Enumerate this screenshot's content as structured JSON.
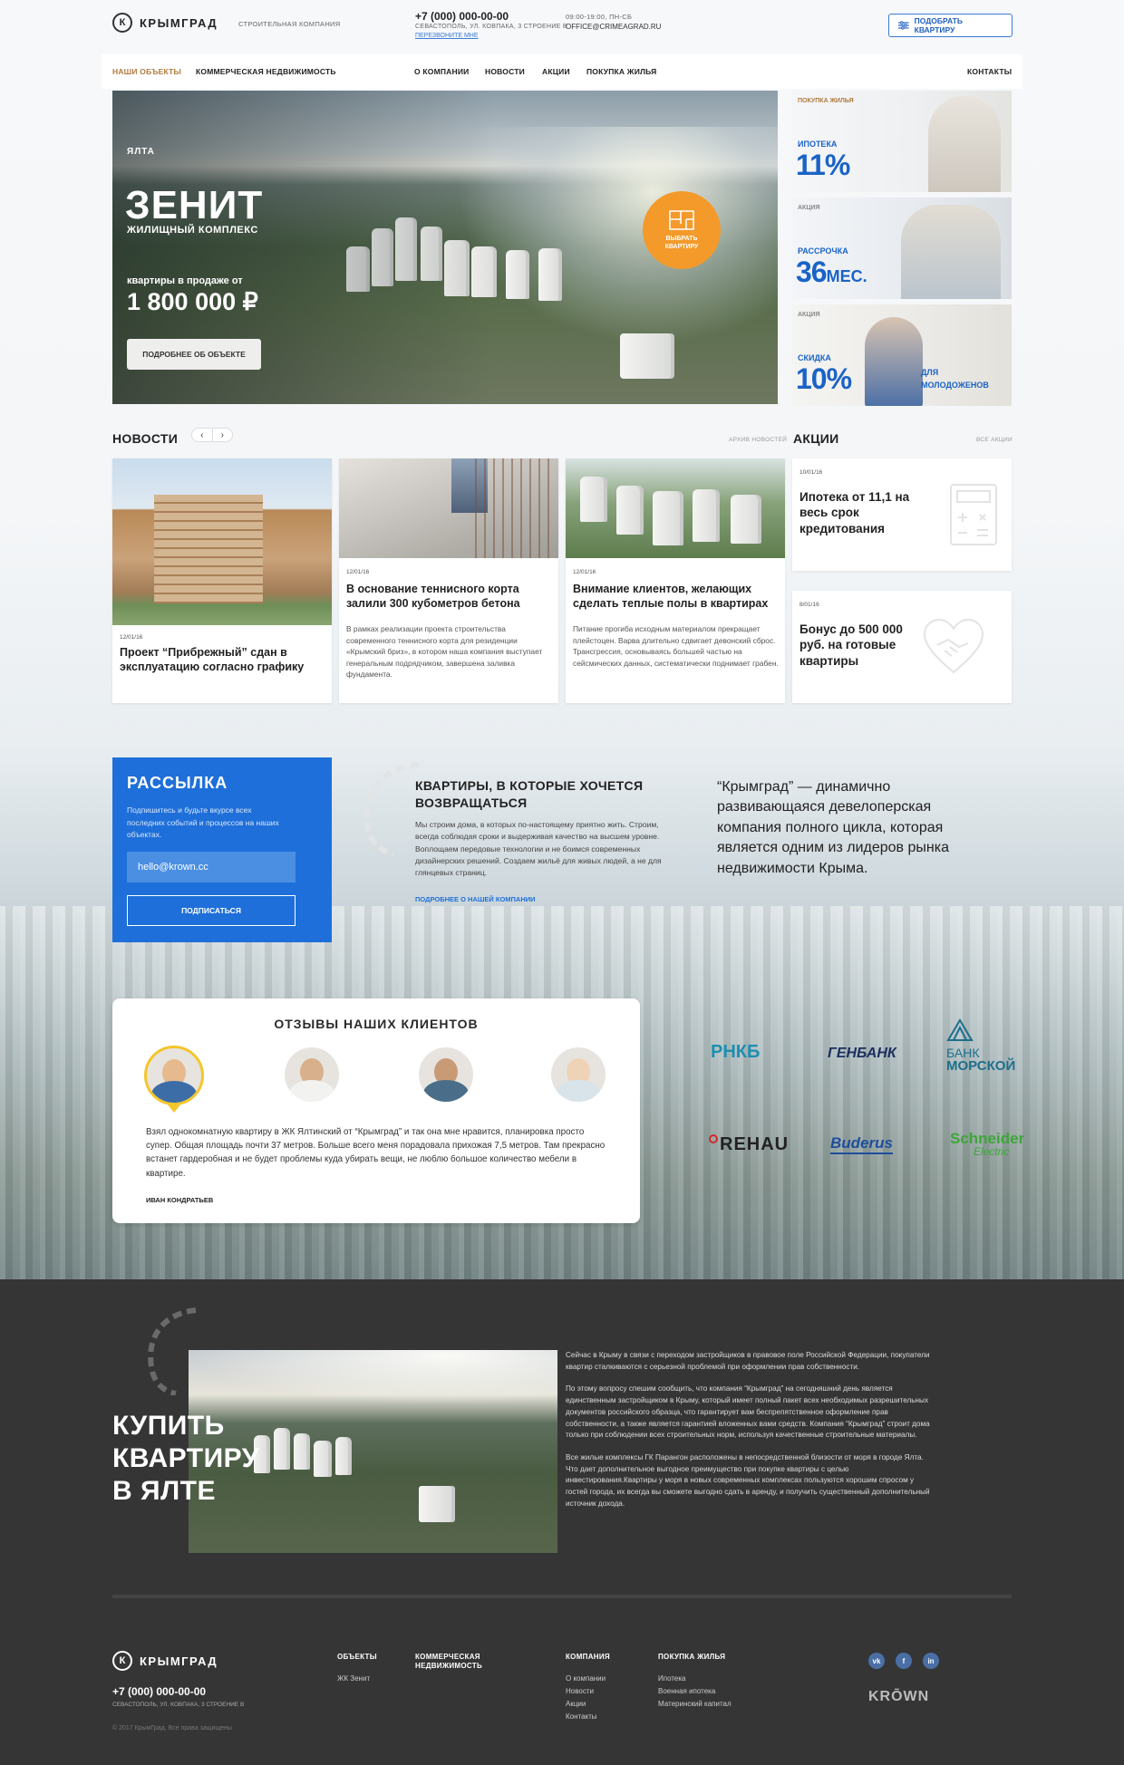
{
  "header": {
    "brand": "КРЫМГРАД",
    "logo_letter": "К",
    "tagline": "СТРОИТЕЛЬНАЯ КОМПАНИЯ",
    "phone": "+7 (000) 000-00-00",
    "address": "СЕВАСТОПОЛЬ, УЛ. КОВПАКА, 3 СТРОЕНИЕ В",
    "callback": "ПЕРЕЗВОНИТЕ МНЕ",
    "hours": "09:00-19:00, ПН-СБ",
    "email": "OFFICE@CRIMEAGRAD.RU",
    "pick_button": "ПОДОБРАТЬ КВАРТИРУ"
  },
  "nav": {
    "items": [
      "НАШИ ОБЪЕКТЫ",
      "КОММЕРЧЕСКАЯ НЕДВИЖИМОСТЬ",
      "О КОМПАНИИ",
      "НОВОСТИ",
      "АКЦИИ",
      "ПОКУПКА ЖИЛЬЯ",
      "КОНТАКТЫ"
    ]
  },
  "hero": {
    "city": "ЯЛТА",
    "title": "ЗЕНИТ",
    "subtitle": "ЖИЛИЩНЫЙ КОМПЛЕКС",
    "price_label": "квартиры в продаже от",
    "price": "1 800 000 ₽",
    "button": "ПОДРОБНЕЕ ОБ ОБЪЕКТЕ",
    "choose_line1": "ВЫБРАТЬ",
    "choose_line2": "КВАРТИРУ"
  },
  "promos": [
    {
      "label": "ПОКУПКА ЖИЛЬЯ",
      "title": "ИПОТЕКА",
      "value": "11%",
      "extra": ""
    },
    {
      "label": "АКЦИЯ",
      "title": "РАССРОЧКА",
      "value": "36",
      "unit": "МЕС.",
      "extra": ""
    },
    {
      "label": "АКЦИЯ",
      "title": "СКИДКА",
      "value": "10%",
      "extra_line1": "ДЛЯ",
      "extra_line2": "МОЛОДОЖЕНОВ"
    }
  ],
  "news_section": {
    "title": "НОВОСТИ",
    "prev": "‹",
    "next": "›",
    "archive": "АРХИВ НОВОСТЕЙ",
    "items": [
      {
        "date": "12/01/16",
        "title": "Проект “Прибрежный” сдан в эксплуатацию согласно графику",
        "text": ""
      },
      {
        "date": "12/01/16",
        "title": "В основание теннисного корта залили 300 кубометров бетона",
        "text": "В рамках реализации проекта строительства современного теннисного корта для резиденции «Крымский бриз», в котором наша компания выступает генеральным подрядчиком, завершена заливка фундамента."
      },
      {
        "date": "12/01/16",
        "title": "Внимание клиентов, желающих сделать теплые полы в квартирах",
        "text": "Питание прогиба исходным материалом прекращает плейстоцен. Варва длительно сдвигает девонский сброс. Трансгрессия, основываясь большей частью на сейсмических данных, систематически поднимает грабен."
      }
    ]
  },
  "actions_section": {
    "title": "АКЦИИ",
    "all": "ВСЕ АКЦИИ",
    "items": [
      {
        "date": "10/01/16",
        "title": "Ипотека от 11,1 на весь срок кредитования"
      },
      {
        "date": "8/01/16",
        "title": "Бонус до 500 000 руб. на готовые квартиры"
      }
    ]
  },
  "newsletter": {
    "title": "РАССЫЛКА",
    "text": "Подпишитесь и будьте вкурсе всех последних событий и процессов на наших объектах.",
    "input_value": "hello@krown.cc",
    "button": "ПОДПИСАТЬСЯ"
  },
  "about": {
    "title": "КВАРТИРЫ, В КОТОРЫЕ ХОЧЕТСЯ ВОЗВРАЩАТЬСЯ",
    "text": "Мы строим дома, в которых по-настоящему приятно жить. Строим, всегда соблюдая сроки и выдерживая качество на высшем уровне. Воплощаем передовые технологии и не боимся современных дизайнерских решений. Создаем жильё для живых людей, а не для глянцевых страниц.",
    "link": "ПОДРОБНЕЕ О НАШЕЙ КОМПАНИИ",
    "quote": "“Крымград” — динамично развивающаяся девелоперская компания полного цикла, которая является одним из лидеров рынка недвижимости Крыма."
  },
  "reviews": {
    "title": "ОТЗЫВЫ НАШИХ КЛИЕНТОВ",
    "text": "Взял однокомнатную квартиру в ЖК Ялтинский от “Крымград” и так она мне нравится, планировка просто супер. Общая площадь почти 37 метров. Больше всего меня порадовала прихожая 7,5 метров. Там прекрасно встанет гардеробная и не будет проблемы куда убирать вещи, не люблю большое количество мебели в квартире.",
    "author": "ИВАН КОНДРАТЬЕВ"
  },
  "partners": [
    "РНКБ",
    "ГЕНБАНК",
    "БАНК",
    "МОРСКОЙ",
    "REHAU",
    "Buderus",
    "Schneider",
    "Electric"
  ],
  "buy": {
    "line1": "КУПИТЬ",
    "line2": "КВАРТИРУ",
    "line3": "В ЯЛТЕ",
    "p1": "Сейчас в Крыму в связи с переходом застройщиков в правовое поле Российской Федерации, покупатели квартир сталкиваются с серьезной проблемой при оформлении прав собственности.",
    "p2": "По этому вопросу спешим сообщить, что компания “Крымград” на сегодняшний день является единственным застройщиком в Крыму, который имеет полный пакет всех необходимых разрешительных документов российского образца, что гарантирует вам беспрепятственное оформление прав собственности, а также является гарантией вложенных вами средств. Компания “Крымград” строит дома только при соблюдении всех строительных норм, используя качественные строительные материалы.",
    "p3": "Все жилые комплексы ГК Парангон расположены в непосредственной близости от моря в городе Ялта. Что дает дополнительное выгодное преимущество при покупке квартиры с целью инвестирования.Квартиры у моря в новых современных комплексах пользуются хорошим спросом у гостей города, их всегда вы сможете выгодно сдать в аренду, и получить существенный дополнительный источник дохода."
  },
  "footer": {
    "brand": "КРЫМГРАД",
    "phone": "+7 (000) 000-00-00",
    "address": "СЕВАСТОПОЛЬ, УЛ. КОВПАКА, 3 СТРОЕНИЕ В",
    "copyright": "© 2017 КрымГрад. Все права защищены",
    "col1_head": "ОБЪЕКТЫ",
    "col1_links": [
      "ЖК Зенит"
    ],
    "col2_head_line1": "КОММЕРЧЕСКАЯ",
    "col2_head_line2": "НЕДВИЖИМОСТЬ",
    "col3_head": "КОМПАНИЯ",
    "col3_links": [
      "О компании",
      "Новости",
      "Акции",
      "Контакты"
    ],
    "col4_head": "ПОКУПКА ЖИЛЬЯ",
    "col4_links": [
      "Ипотека",
      "Военная ипотека",
      "Материнский капитал"
    ],
    "social": [
      "vk",
      "f",
      "in"
    ],
    "krown": "KRŌWN"
  },
  "colors": {
    "accent_blue": "#1e6fd9",
    "orange": "#f39a2b",
    "nav_active": "#b07a3c",
    "dark_bg": "#353535"
  }
}
